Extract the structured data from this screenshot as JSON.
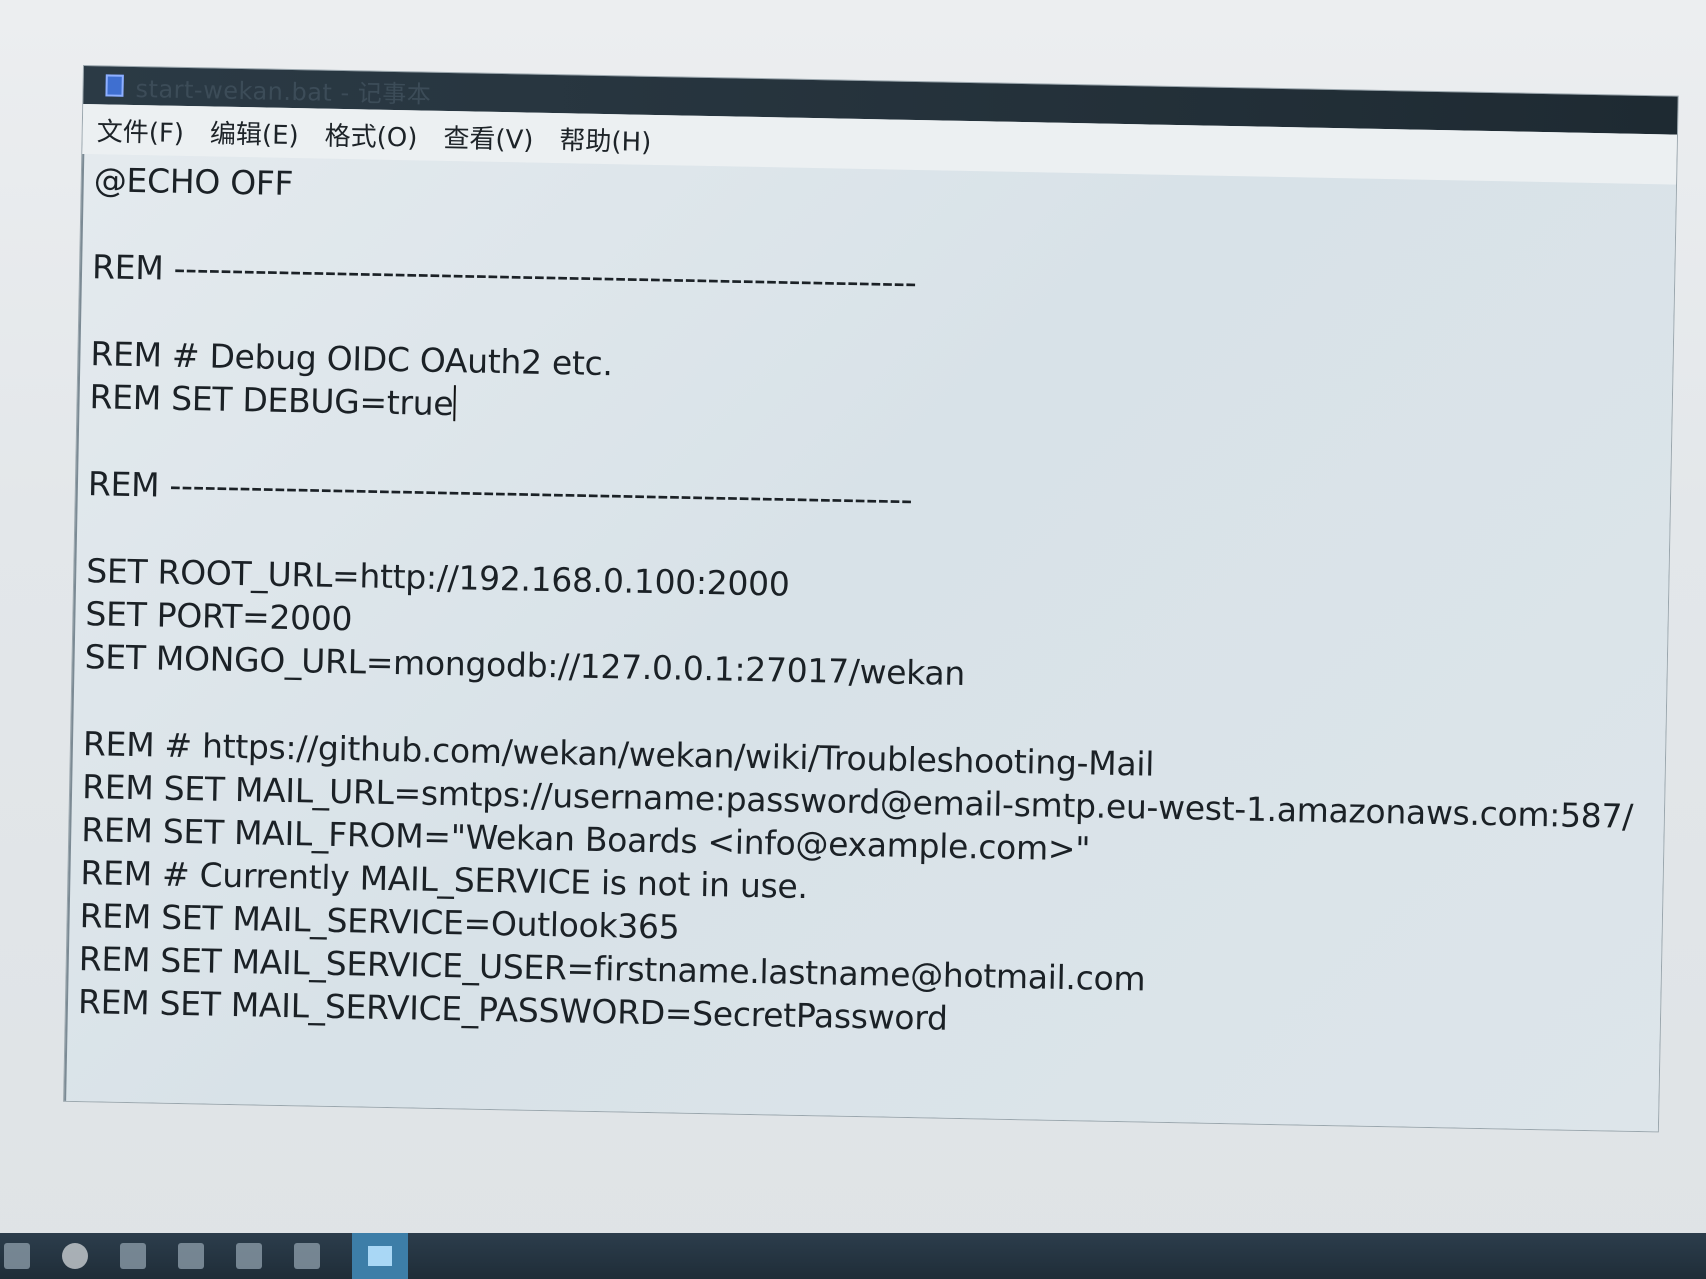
{
  "window": {
    "title": "start-wekan.bat - 记事本"
  },
  "menu": {
    "items": [
      "文件(F)",
      "编辑(E)",
      "格式(O)",
      "查看(V)",
      "帮助(H)"
    ]
  },
  "editor": {
    "lines": [
      "@ECHO OFF",
      "",
      "REM ----------------------------------------------------------------",
      "",
      "REM # Debug OIDC OAuth2 etc.",
      "REM SET DEBUG=true",
      "",
      "REM ----------------------------------------------------------------",
      "",
      "SET ROOT_URL=http://192.168.0.100:2000",
      "SET PORT=2000",
      "SET MONGO_URL=mongodb://127.0.0.1:27017/wekan",
      "",
      "REM # https://github.com/wekan/wekan/wiki/Troubleshooting-Mail",
      "REM SET MAIL_URL=smtps://username:password@email-smtp.eu-west-1.amazonaws.com:587/",
      "REM SET MAIL_FROM=\"Wekan Boards <info@example.com>\"",
      "REM # Currently MAIL_SERVICE is not in use.",
      "REM SET MAIL_SERVICE=Outlook365",
      "REM SET MAIL_SERVICE_USER=firstname.lastname@hotmail.com",
      "REM SET MAIL_SERVICE_PASSWORD=SecretPassword"
    ]
  },
  "taskbar": {
    "icons": [
      "file-explorer-icon",
      "browser-icon",
      "computer-icon",
      "pin-icon",
      "image-viewer-icon",
      "app-icon",
      "notepad-icon"
    ]
  },
  "colors": {
    "titlebar": "#24313a",
    "taskbar": "#1f2d38",
    "active_task": "#3d7ea8"
  }
}
